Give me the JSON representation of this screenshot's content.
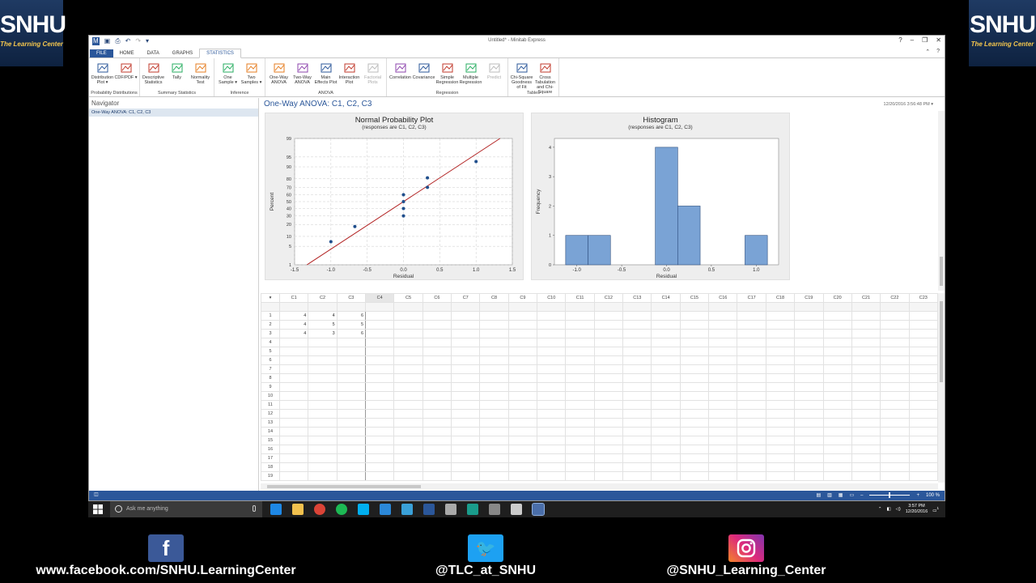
{
  "logos": {
    "big": "SNHU",
    "small": "The Learning Center"
  },
  "window": {
    "title": "Untitled* - Minitab Express"
  },
  "ribbon_tabs": [
    "FILE",
    "HOME",
    "DATA",
    "GRAPHS",
    "STATISTICS"
  ],
  "ribbon": {
    "groups": [
      {
        "name": "Probability Distributions",
        "items": [
          {
            "label": "Distribution Plot ▾"
          },
          {
            "label": "CDF/PDF ▾"
          }
        ]
      },
      {
        "name": "Summary Statistics",
        "items": [
          {
            "label": "Descriptive Statistics"
          },
          {
            "label": "Tally"
          },
          {
            "label": "Normality Test"
          }
        ]
      },
      {
        "name": "Inference",
        "items": [
          {
            "label": "One Sample ▾"
          },
          {
            "label": "Two Samples ▾"
          }
        ]
      },
      {
        "name": "ANOVA",
        "items": [
          {
            "label": "One-Way ANOVA"
          },
          {
            "label": "Two-Way ANOVA"
          },
          {
            "label": "Main Effects Plot"
          },
          {
            "label": "Interaction Plot"
          },
          {
            "label": "Factorial Plots"
          }
        ]
      },
      {
        "name": "Regression",
        "items": [
          {
            "label": "Correlation"
          },
          {
            "label": "Covariance"
          },
          {
            "label": "Simple Regression"
          },
          {
            "label": "Multiple Regression"
          },
          {
            "label": "Predict"
          }
        ]
      },
      {
        "name": "Tables",
        "items": [
          {
            "label": "Chi-Square Goodness of Fit"
          },
          {
            "label": "Cross Tabulation and Chi-Square"
          }
        ]
      }
    ]
  },
  "navigator": {
    "title": "Navigator",
    "items": [
      "One-Way ANOVA: C1, C2, C3"
    ]
  },
  "output": {
    "title": "One-Way ANOVA: C1, C2, C3",
    "date": "12/20/2016 3:56:48 PM"
  },
  "chart_data": [
    {
      "type": "scatter",
      "title": "Normal Probability Plot",
      "subtitle": "(responses are C1, C2, C3)",
      "xlabel": "Residual",
      "ylabel": "Percent",
      "xlim": [
        -1.5,
        1.5
      ],
      "y_scale": "normal-probability",
      "xticks": [
        -1.5,
        -1.0,
        -0.5,
        0.0,
        0.5,
        1.0,
        1.5
      ],
      "xtick_labels": [
        "-1.5",
        "-1.0",
        "-0.5",
        "0.0",
        "0.5",
        "1.0",
        "1.5"
      ],
      "yticks": [
        1,
        5,
        10,
        20,
        30,
        40,
        50,
        60,
        70,
        80,
        90,
        95,
        99
      ],
      "points": [
        {
          "x": -1.0,
          "y": 7
        },
        {
          "x": -0.67,
          "y": 18
        },
        {
          "x": 0.0,
          "y": 30
        },
        {
          "x": 0.0,
          "y": 40
        },
        {
          "x": 0.0,
          "y": 50
        },
        {
          "x": 0.0,
          "y": 60
        },
        {
          "x": 0.33,
          "y": 70
        },
        {
          "x": 0.33,
          "y": 81
        },
        {
          "x": 1.0,
          "y": 93
        }
      ],
      "fit_line": [
        {
          "x": -1.33,
          "y": 1
        },
        {
          "x": 1.33,
          "y": 99
        }
      ],
      "grid": true,
      "colors": {
        "points": "#1f4e8c",
        "line": "#b22222"
      }
    },
    {
      "type": "bar",
      "title": "Histogram",
      "subtitle": "(responses are C1, C2, C3)",
      "xlabel": "Residual",
      "ylabel": "Frequency",
      "bins": [
        {
          "center": -1.0,
          "count": 1
        },
        {
          "center": -0.75,
          "count": 1
        },
        {
          "center": 0.0,
          "count": 4
        },
        {
          "center": 0.25,
          "count": 2
        },
        {
          "center": 1.0,
          "count": 1
        }
      ],
      "bin_width": 0.25,
      "xlim": [
        -1.25,
        1.25
      ],
      "ylim": [
        0,
        4.3
      ],
      "xticks": [
        -1.0,
        -0.5,
        0.0,
        0.5,
        1.0
      ],
      "xtick_labels": [
        "-1.0",
        "-0.5",
        "0.0",
        "0.5",
        "1.0"
      ],
      "yticks": [
        0,
        1,
        2,
        3,
        4
      ],
      "colors": {
        "bar": "#7aa3d5",
        "edge": "#2f4f7f"
      }
    }
  ],
  "worksheet": {
    "columns": [
      "C1",
      "C2",
      "C3",
      "C4",
      "C5",
      "C6",
      "C7",
      "C8",
      "C9",
      "C10",
      "C11",
      "C12",
      "C13",
      "C14",
      "C15",
      "C16",
      "C17",
      "C18",
      "C19",
      "C20",
      "C21",
      "C22",
      "C23"
    ],
    "rows": [
      [
        "4",
        "4",
        "6"
      ],
      [
        "4",
        "5",
        "5"
      ],
      [
        "4",
        "3",
        "6"
      ],
      [],
      [],
      [],
      [],
      [],
      [],
      [],
      [],
      [],
      [],
      [],
      [],
      [],
      [],
      [],
      []
    ]
  },
  "statusbar": {
    "zoom": "100 %"
  },
  "taskbar": {
    "search_placeholder": "Ask me anything",
    "time": "3:57 PM",
    "date": "12/20/2016",
    "notif_count": "1"
  },
  "social": [
    {
      "icon": "facebook-icon",
      "label": "www.facebook.com/SNHU.LearningCenter",
      "color": "#3b5998"
    },
    {
      "icon": "twitter-icon",
      "label": "@TLC_at_SNHU",
      "color": "#1da1f2"
    },
    {
      "icon": "instagram-icon",
      "label": "@SNHU_Learning_Center",
      "color": "#c13584"
    }
  ]
}
